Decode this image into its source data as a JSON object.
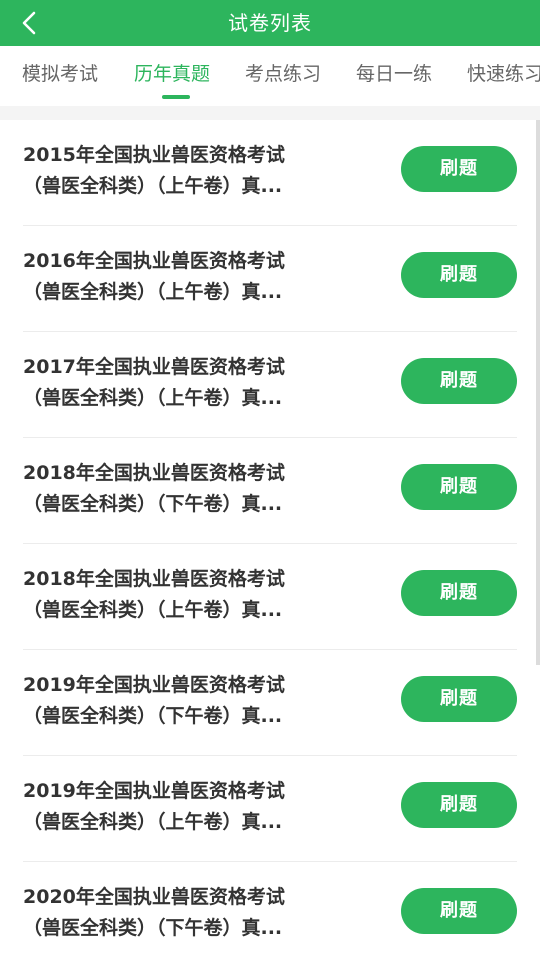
{
  "header": {
    "title": "试卷列表",
    "back_icon": "chevron-left-icon"
  },
  "tabs": [
    {
      "label": "模拟考试",
      "active": false
    },
    {
      "label": "历年真题",
      "active": true
    },
    {
      "label": "考点练习",
      "active": false
    },
    {
      "label": "每日一练",
      "active": false
    },
    {
      "label": "快速练习",
      "active": false
    }
  ],
  "colors": {
    "accent": "#2db55d",
    "text": "#333333",
    "muted": "#666666"
  },
  "list": {
    "button_label": "刷题",
    "items": [
      {
        "line1": "2015年全国执业兽医资格考试",
        "line2": "（兽医全科类）（上午卷）真..."
      },
      {
        "line1": "2016年全国执业兽医资格考试",
        "line2": "（兽医全科类）（上午卷）真..."
      },
      {
        "line1": "2017年全国执业兽医资格考试",
        "line2": "（兽医全科类）（上午卷）真..."
      },
      {
        "line1": "2018年全国执业兽医资格考试",
        "line2": "（兽医全科类）（下午卷）真..."
      },
      {
        "line1": "2018年全国执业兽医资格考试",
        "line2": "（兽医全科类）（上午卷）真..."
      },
      {
        "line1": "2019年全国执业兽医资格考试",
        "line2": "（兽医全科类）（下午卷）真..."
      },
      {
        "line1": "2019年全国执业兽医资格考试",
        "line2": "（兽医全科类）（上午卷）真..."
      },
      {
        "line1": "2020年全国执业兽医资格考试",
        "line2": "（兽医全科类）（下午卷）真..."
      }
    ]
  }
}
